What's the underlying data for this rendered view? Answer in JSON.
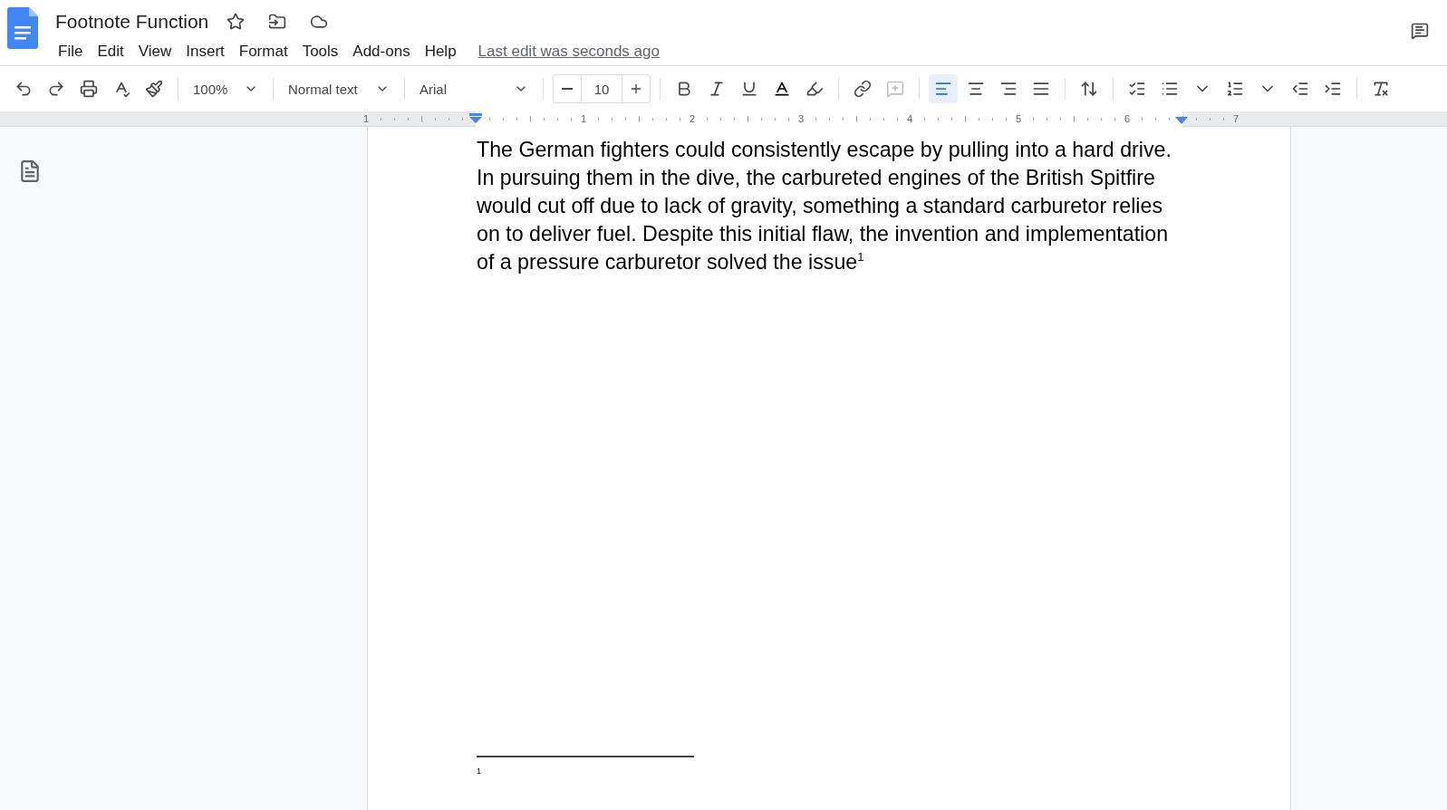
{
  "document": {
    "title": "Footnote Function"
  },
  "menu": [
    "File",
    "Edit",
    "View",
    "Insert",
    "Format",
    "Tools",
    "Add-ons",
    "Help"
  ],
  "last_edit": "Last edit was seconds ago",
  "toolbar": {
    "zoom": "100%",
    "style": "Normal text",
    "font": "Arial",
    "font_size": "10",
    "alignment": [
      {
        "selected": true
      },
      {
        "selected": false
      },
      {
        "selected": false
      },
      {
        "selected": false
      }
    ]
  },
  "ruler": {
    "labels": [
      "1",
      "1",
      "2",
      "3",
      "4",
      "5",
      "6",
      "7"
    ]
  },
  "body": {
    "paragraph": "The German fighters could consistently escape by pulling into a hard drive. In pursuing them in the dive, the carbureted engines of the British Spitfire would cut off due to lack of gravity, something a standard carburetor relies on to deliver fuel. Despite this initial flaw, the invention and implementation of a pressure carburetor solved the issue$^{1}$"
  },
  "footnotes": [
    {
      "number": "1"
    }
  ]
}
